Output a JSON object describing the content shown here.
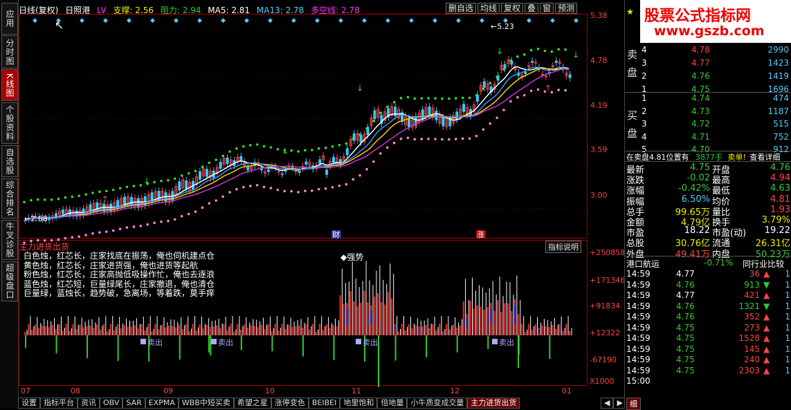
{
  "nav": [
    {
      "id": "apps",
      "label": "应用"
    },
    {
      "id": "timeline",
      "label": "分时图"
    },
    {
      "id": "kline",
      "label": "K线图"
    },
    {
      "id": "profile",
      "label": "个股资料"
    },
    {
      "id": "watch",
      "label": "自选股"
    },
    {
      "id": "rank",
      "label": "综合排名"
    },
    {
      "id": "niucha",
      "label": "牛叉诊股"
    },
    {
      "id": "l2",
      "label": "超级盘口"
    }
  ],
  "header": {
    "period": "日线(复权)",
    "name": "日照港",
    "lv": "LV",
    "support": "支撑: 2.56",
    "resist": "阻力: 2.94",
    "ma5": "MA5: 2.81",
    "ma13": "MA13: 2.78",
    "duokong": "多空线: 2.78"
  },
  "toolbar": [
    "删自选",
    "均线",
    "复权",
    "叠",
    "窗",
    "预测"
  ],
  "main_chart": {
    "y_ticks": [
      "5.38",
      "4.78",
      "4.19",
      "3.59",
      "3.00"
    ],
    "high_label": "5.23",
    "low_label": "2.68",
    "event_cai": "财",
    "event_zhang": "涨"
  },
  "indicator": {
    "title": "主力进货出货",
    "help_button": "指标说明",
    "legend": [
      "白色烛，红芯长，庄家找底在振荡，俺也伺机建点仓",
      "黄色烛，红芯长，庄家进货强，俺也进货等起航",
      "粉色烛，红芯长，庄家高抛低吸操作忙，俺也去逐浪",
      "蓝色烛，红芯短，巨量绿尾长，庄家撤退，俺也清仓",
      "巨量绿，蓝烛长，趋势破，急离场，等着跌，莫手痒"
    ],
    "strong_label": "◆强势",
    "sell_label": "卖出",
    "y_ticks": [
      "+250858",
      "+171346",
      "+91834",
      "+12322",
      "-67190"
    ],
    "unit": "X1000"
  },
  "x_axis": [
    "07",
    "08",
    "09",
    "10",
    "11",
    "12",
    "01"
  ],
  "bottom_tabs": [
    "设置",
    "指标平台",
    "资讯",
    "OBV",
    "SAR",
    "EXPMA",
    "WBB中短买卖",
    "希望之星",
    "涨停变色",
    "BEIBEI",
    "地里饱和",
    "倍地量",
    "小牛质变成交量",
    "主力进货出货"
  ],
  "logo": {
    "line1": "股票公式指标网",
    "line2": "www.gszb.com"
  },
  "orderbook": {
    "sell_label": "卖盘",
    "buy_label": "买盘",
    "asks": [
      {
        "lvl": "4",
        "price": "4.78",
        "vol": "2990"
      },
      {
        "lvl": "3",
        "price": "4.77",
        "vol": "1423"
      },
      {
        "lvl": "2",
        "price": "4.76",
        "vol": "1419"
      },
      {
        "lvl": "1",
        "price": "4.75",
        "vol": "1696"
      }
    ],
    "bids": [
      {
        "lvl": "1",
        "price": "4.74",
        "vol": "474"
      },
      {
        "lvl": "2",
        "price": "4.73",
        "vol": "1187"
      },
      {
        "lvl": "3",
        "price": "4.72",
        "vol": "515"
      },
      {
        "lvl": "4",
        "price": "4.71",
        "vol": "752"
      },
      {
        "lvl": "5",
        "price": "4.70",
        "vol": "912"
      }
    ],
    "pos_text": "在卖盘4.81位置有",
    "pos_vol": "3877手",
    "pos_sell": "卖单!",
    "pos_detail": "查看详细"
  },
  "stats": [
    {
      "k1": "最新",
      "v1": "4.75",
      "c1": "g",
      "k2": "开盘",
      "v2": "4.76",
      "c2": "g"
    },
    {
      "k1": "涨跌",
      "v1": "-0.02",
      "c1": "g",
      "k2": "最高",
      "v2": "4.94",
      "c2": "r"
    },
    {
      "k1": "涨幅",
      "v1": "-0.42%",
      "c1": "g",
      "k2": "最低",
      "v2": "4.63",
      "c2": "g"
    },
    {
      "k1": "振幅",
      "v1": "6.50%",
      "c1": "c",
      "k2": "均价",
      "v2": "4.81",
      "c2": "r"
    },
    {
      "k1": "总手",
      "v1": "99.65万",
      "c1": "y",
      "k2": "量比",
      "v2": "1.93",
      "c2": "r"
    },
    {
      "k1": "金额",
      "v1": "4.79亿",
      "c1": "y",
      "k2": "换手",
      "v2": "3.79%",
      "c2": "y"
    },
    {
      "k1": "市盈",
      "v1": "18.22",
      "c1": "w",
      "k2": "市盈(动)",
      "v2": "19.22",
      "c2": "w"
    },
    {
      "k1": "总股",
      "v1": "30.76亿",
      "c1": "y",
      "k2": "流通",
      "v2": "26.31亿",
      "c2": "y"
    },
    {
      "k1": "外盘",
      "v1": "49.41万",
      "c1": "r",
      "k2": "内盘",
      "v2": "50.23万",
      "c2": "g"
    }
  ],
  "sector": {
    "name": "港口航运",
    "change": "-0.71%",
    "compare": "同行业比较"
  },
  "trades": [
    {
      "t": "14:59",
      "p": "4.77",
      "pc": "w",
      "v": "36",
      "dir": "up",
      "n": "1"
    },
    {
      "t": "14:59",
      "p": "4.76",
      "pc": "g",
      "v": "913",
      "dir": "down",
      "n": "1"
    },
    {
      "t": "14:59",
      "p": "4.77",
      "pc": "w",
      "v": "421",
      "dir": "up",
      "n": "1"
    },
    {
      "t": "14:59",
      "p": "4.76",
      "pc": "g",
      "v": "1321",
      "dir": "down",
      "n": "1"
    },
    {
      "t": "14:59",
      "p": "4.76",
      "pc": "g",
      "v": "352",
      "dir": "up",
      "n": "1"
    },
    {
      "t": "14:59",
      "p": "4.75",
      "pc": "g",
      "v": "273",
      "dir": "up",
      "n": "1"
    },
    {
      "t": "14:59",
      "p": "4.75",
      "pc": "g",
      "v": "1528",
      "dir": "up",
      "n": "1"
    },
    {
      "t": "14:59",
      "p": "4.75",
      "pc": "g",
      "v": "145",
      "dir": "up",
      "n": "1"
    },
    {
      "t": "14:59",
      "p": "4.75",
      "pc": "g",
      "v": "240",
      "dir": "up",
      "n": "1"
    },
    {
      "t": "14:59",
      "p": "4.75",
      "pc": "g",
      "v": "2303",
      "dir": "up",
      "n": "1"
    },
    {
      "t": "15:00",
      "p": "",
      "pc": "g",
      "v": "",
      "dir": "",
      "n": ""
    }
  ],
  "bottom_right_tab": "细"
}
